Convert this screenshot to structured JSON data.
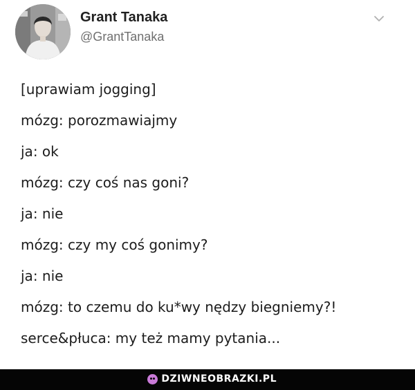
{
  "author": {
    "display_name": "Grant Tanaka",
    "handle": "@GrantTanaka"
  },
  "icons": {
    "avatar": "profile-photo",
    "menu": "chevron-down-icon",
    "brand": "brand-logo-icon"
  },
  "tweet": {
    "lines": [
      "[uprawiam jogging]",
      "mózg: porozmawiajmy",
      "ja: ok",
      "mózg: czy coś nas goni?",
      "ja: nie",
      "mózg: czy my coś gonimy?",
      "ja: nie",
      "mózg: to czemu do ku*wy nędzy biegniemy?!",
      "serce&płuca: my też mamy pytania..."
    ]
  },
  "footer": {
    "watermark": "DZIWNEOBRAZKI.PL",
    "background_color": "#050505",
    "logo_color": "#c97ad8"
  }
}
